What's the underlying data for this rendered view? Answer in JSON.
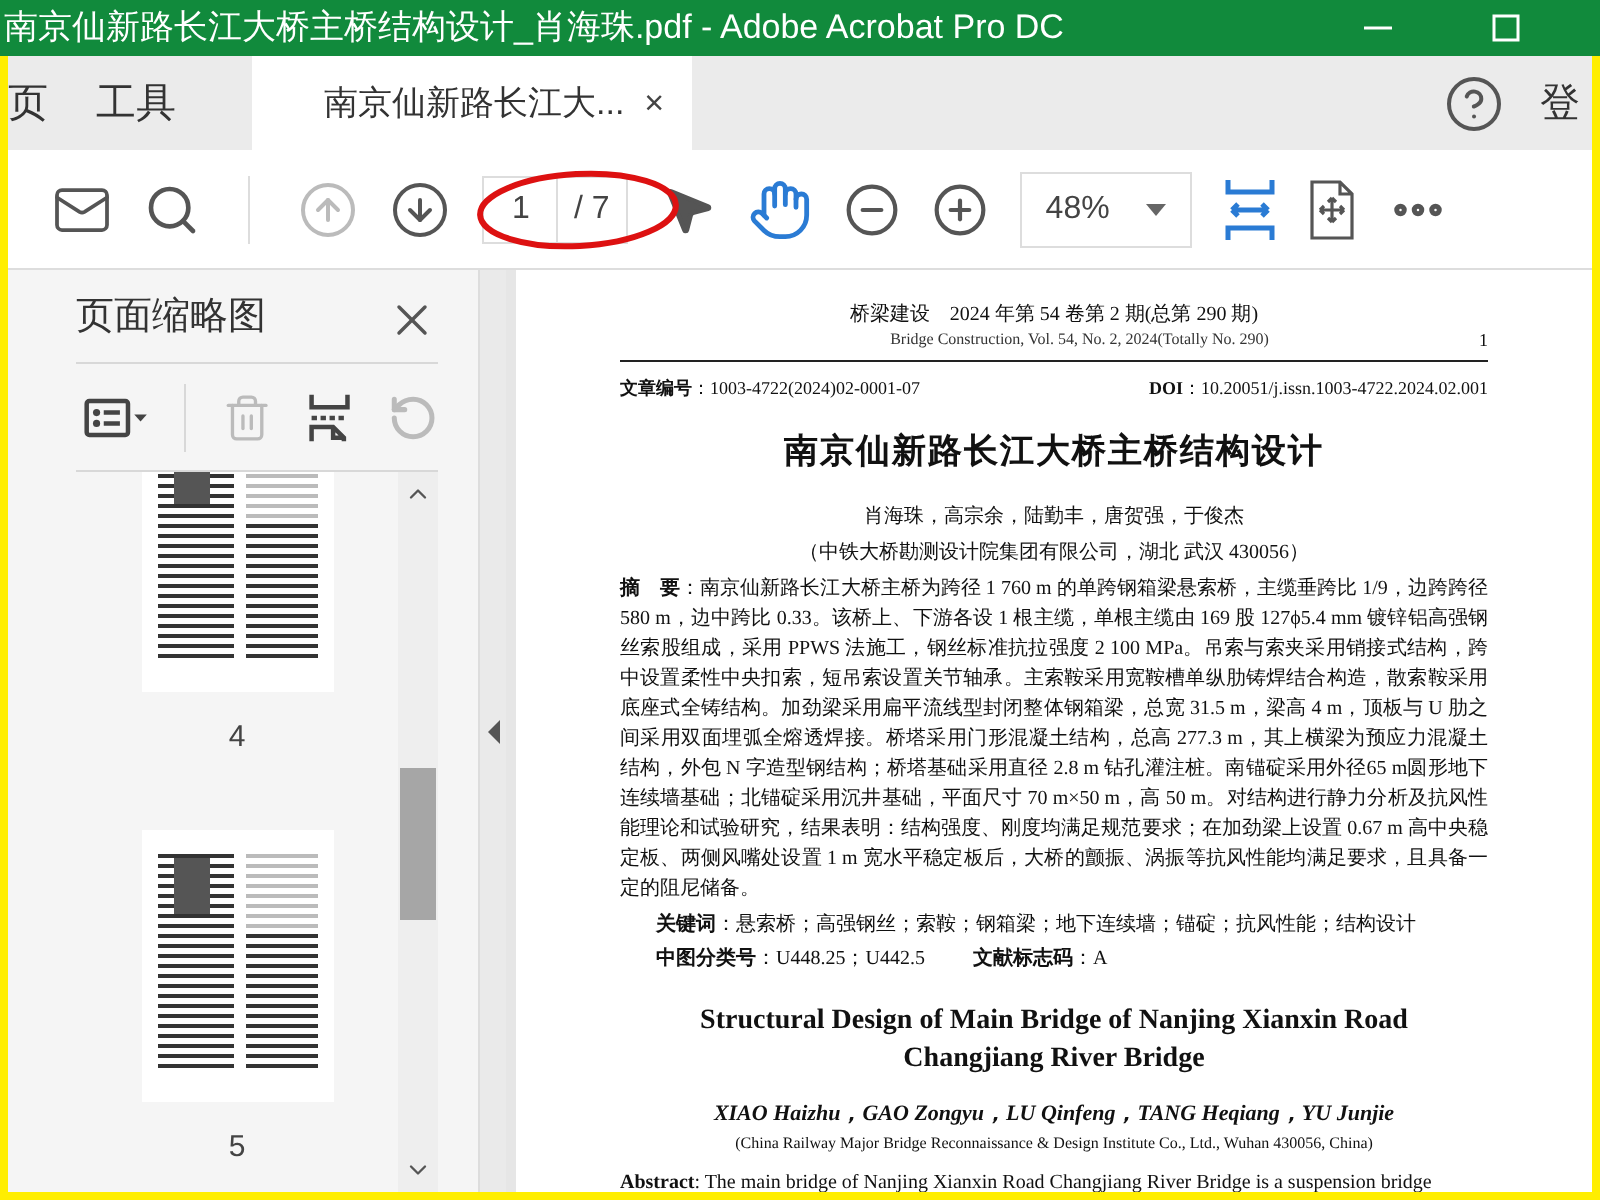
{
  "window": {
    "title": "南京仙新路长江大桥主桥结构设计_肖海珠.pdf - Adobe Acrobat Pro DC"
  },
  "nav_tabs": [
    {
      "label": "页"
    },
    {
      "label": "工具"
    }
  ],
  "doc_tab": {
    "label": "南京仙新路长江大...",
    "close": "×"
  },
  "signin": "登",
  "toolbar": [
    {
      "kind": "mail"
    },
    {
      "kind": "search"
    },
    {
      "kind": "divider"
    },
    {
      "kind": "prev",
      "disabled": true
    },
    {
      "kind": "next",
      "disabled": false
    },
    {
      "kind": "page"
    },
    {
      "kind": "pointer"
    },
    {
      "kind": "hand"
    },
    {
      "kind": "zoom_out"
    },
    {
      "kind": "zoom_in"
    },
    {
      "kind": "zoom"
    },
    {
      "kind": "fit"
    },
    {
      "kind": "fullscreen"
    },
    {
      "kind": "more"
    }
  ],
  "page_field": {
    "value": "1",
    "total": "/ 7"
  },
  "zoom_field": {
    "value": "48%"
  },
  "sidebar": {
    "title": "页面缩略图",
    "tools": [
      {
        "kind": "options",
        "disabled": false
      },
      {
        "kind": "delete",
        "disabled": true
      },
      {
        "kind": "insert",
        "disabled": false
      },
      {
        "kind": "rotate",
        "disabled": true
      }
    ],
    "thumbnails": [
      {
        "label": "4"
      },
      {
        "label": "5"
      }
    ]
  },
  "document": {
    "journal_cn": "桥梁建设　2024 年第 54 卷第 2 期(总第 290 期)",
    "journal_en": "Bridge Construction, Vol. 54, No. 2, 2024(Totally No. 290)",
    "page_number": "1",
    "article_no": "**文章编号**：1003-4722(2024)02-0001-07",
    "doi": "**DOI**：10.20051/j.issn.1003-4722.2024.02.001",
    "title": "南京仙新路长江大桥主桥结构设计",
    "authors": "肖海珠，高宗余，陆勤丰，唐贺强，于俊杰",
    "affiliation": "（中铁大桥勘测设计院集团有限公司，湖北 武汉 430056）",
    "abstract": "**摘　要**：南京仙新路长江大桥主桥为跨径 1 760 m 的单跨钢箱梁悬索桥，主缆垂跨比 1/9，边跨跨径 580 m，边中跨比 0.33。该桥上、下游各设 1 根主缆，单根主缆由 169 股 127ϕ5.4 mm 镀锌铝高强钢丝索股组成，采用 PPWS 法施工，钢丝标准抗拉强度 2 100 MPa。吊索与索夹采用销接式结构，跨中设置柔性中央扣索，短吊索设置关节轴承。主索鞍采用宽鞍槽单纵肋铸焊结合构造，散索鞍采用底座式全铸结构。加劲梁采用扁平流线型封闭整体钢箱梁，总宽 31.5 m，梁高 4 m，顶板与 U 肋之间采用双面埋弧全熔透焊接。桥塔采用门形混凝土结构，总高 277.3 m，其上横梁为预应力混凝土结构，外包 N 字造型钢结构；桥塔基础采用直径 2.8 m 钻孔灌注桩。南锚碇采用外径65 m圆形地下连续墙基础；北锚碇采用沉井基础，平面尺寸 70 m×50 m，高 50 m。对结构进行静力分析及抗风性能理论和试验研究，结果表明：结构强度、刚度均满足规范要求；在加劲梁上设置 0.67 m 高中央稳定板、两侧风嘴处设置 1 m 宽水平稳定板后，大桥的颤振、涡振等抗风性能均满足要求，且具备一定的阻尼储备。",
    "keywords": "**关键词**：悬索桥；高强钢丝；索鞍；钢箱梁；地下连续墙；锚碇；抗风性能；结构设计",
    "classification": "**中图分类号**：U448.25；U442.5",
    "doc_code": "**文献标志码**：A",
    "title_en": "Structural Design of Main Bridge of Nanjing Xianxin Road Changjiang River Bridge",
    "authors_en": "XIAO Haizhu，GAO Zongyu，LU Qinfeng，TANG Heqiang，YU Junjie",
    "affiliation_en": "(China Railway Major Bridge Reconnaissance & Design Institute Co., Ltd., Wuhan 430056, China)",
    "abstract_en": "**Abstract**: The main bridge of Nanjing Xianxin Road Changjiang River Bridge is a suspension bridge"
  }
}
